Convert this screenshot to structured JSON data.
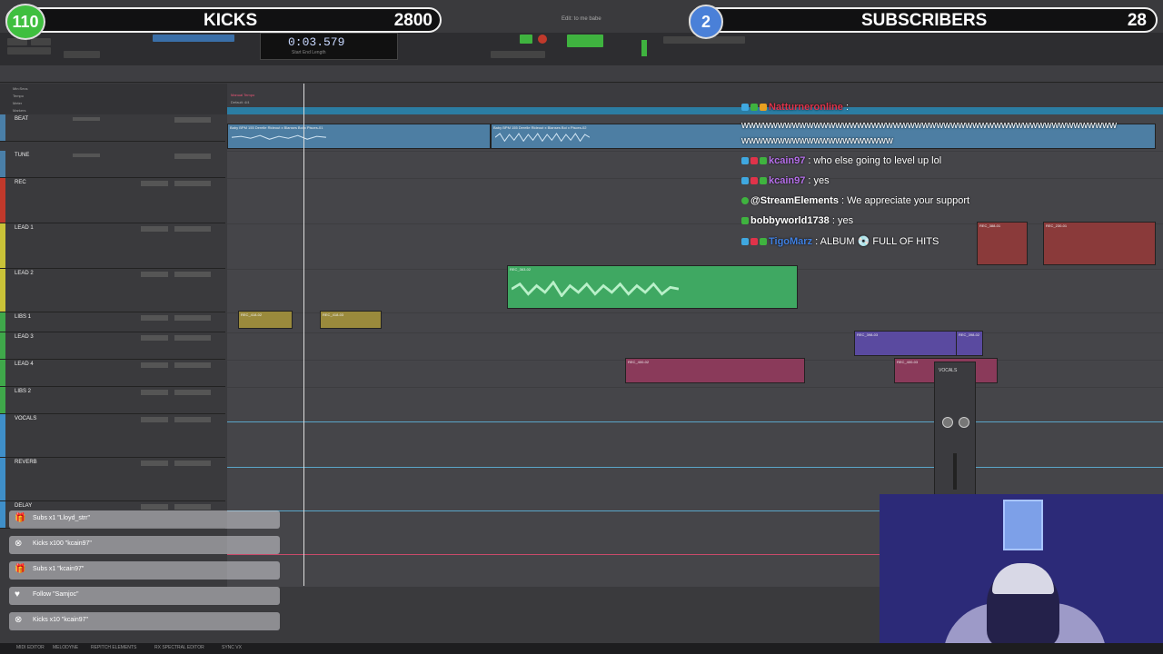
{
  "overlay": {
    "kicks": {
      "badge": "110",
      "title": "KICKS",
      "count": "2800"
    },
    "subscribers": {
      "badge": "2",
      "title": "SUBSCRIBERS",
      "count": "28"
    }
  },
  "app": {
    "window_title": "Edit: to me babe",
    "counter_main": "0:03.579",
    "counter_sub": "Start  End  Length"
  },
  "ruler": {
    "labels": [
      "Min:Secs",
      "Tempo",
      "Meter",
      "Markers"
    ],
    "tempo_label": "Manual Tempo",
    "meter_label": "Default: 4/4"
  },
  "tracks": [
    {
      "name": "BEAT",
      "color": "#4a7fa8"
    },
    {
      "name": "TUNE",
      "color": "#4a7fa8"
    },
    {
      "name": "REC",
      "color": "#c0392b"
    },
    {
      "name": "LEAD 1",
      "color": "#c9c238"
    },
    {
      "name": "LEAD 2",
      "color": "#c9c238"
    },
    {
      "name": "LIBS 1",
      "color": "#3fa84a"
    },
    {
      "name": "LEAD 3",
      "color": "#3fa84a"
    },
    {
      "name": "LEAD 4",
      "color": "#3fa84a"
    },
    {
      "name": "LIBS 2",
      "color": "#3fa84a"
    },
    {
      "name": "VOCALS",
      "color": "#3f8fc9"
    },
    {
      "name": "REVERB",
      "color": "#3f8fc9"
    },
    {
      "name": "DELAY",
      "color": "#3f8fc9"
    }
  ],
  "clips": [
    {
      "name": "Baby BPM 155 Derelle Rideout x Blanses Boi x Pisces-01"
    },
    {
      "name": "Baby BPM 155 Derelle Rideout x Blanses Boi x Pisces-02"
    },
    {
      "name": "REC_363-02"
    },
    {
      "name": "REC_418-02"
    },
    {
      "name": "REC_418-03"
    },
    {
      "name": "REC_400-02"
    },
    {
      "name": "REC_398-03"
    },
    {
      "name": "REC_398-02"
    },
    {
      "name": "REC_400-03"
    },
    {
      "name": "REC_388-01"
    },
    {
      "name": "REC_230-01"
    }
  ],
  "chat": [
    {
      "user": "Natturneronline",
      "text": " :",
      "user_color": "#e0334a"
    },
    {
      "user": "",
      "text": "wwwwwwwwwwwwwwwwwwwwwwwwwwwwwwwwwwwwwwwwwwwwwwwwwwww",
      "user_color": "#ffffff"
    },
    {
      "user": "",
      "text": "wwwwwwwwwwwwwwwwwwwww",
      "user_color": "#ffffff"
    },
    {
      "user": "kcain97",
      "text": " : who else going to level up lol",
      "user_color": "#b46ee8"
    },
    {
      "user": "kcain97",
      "text": " : yes",
      "user_color": "#b46ee8"
    },
    {
      "user": "@StreamElements",
      "text": " : We appreciate your support",
      "user_color": "#ffffff"
    },
    {
      "user": "bobbyworld1738",
      "text": " : yes",
      "user_color": "#ffffff"
    },
    {
      "user": "TigoMarz",
      "text": " : ALBUM 💿 FULL OF HITS",
      "user_color": "#3f7fe0"
    }
  ],
  "alerts": [
    {
      "icon": "🎁",
      "text": "Subs x1 \"Lloyd_strr\""
    },
    {
      "icon": "⊗",
      "text": "Kicks x100 \"kcain97\""
    },
    {
      "icon": "🎁",
      "text": "Subs x1 \"kcain97\""
    },
    {
      "icon": "♥",
      "text": "Follow \"Samjoc\""
    },
    {
      "icon": "⊗",
      "text": "Kicks x10 \"kcain97\""
    }
  ],
  "mixer": {
    "label": "VOCALS"
  },
  "status_bar": [
    "MIDI EDITOR",
    "MELODYNE",
    "REPITCH ELEMENTS",
    "RX SPECTRAL EDITOR",
    "SYNC VX"
  ]
}
